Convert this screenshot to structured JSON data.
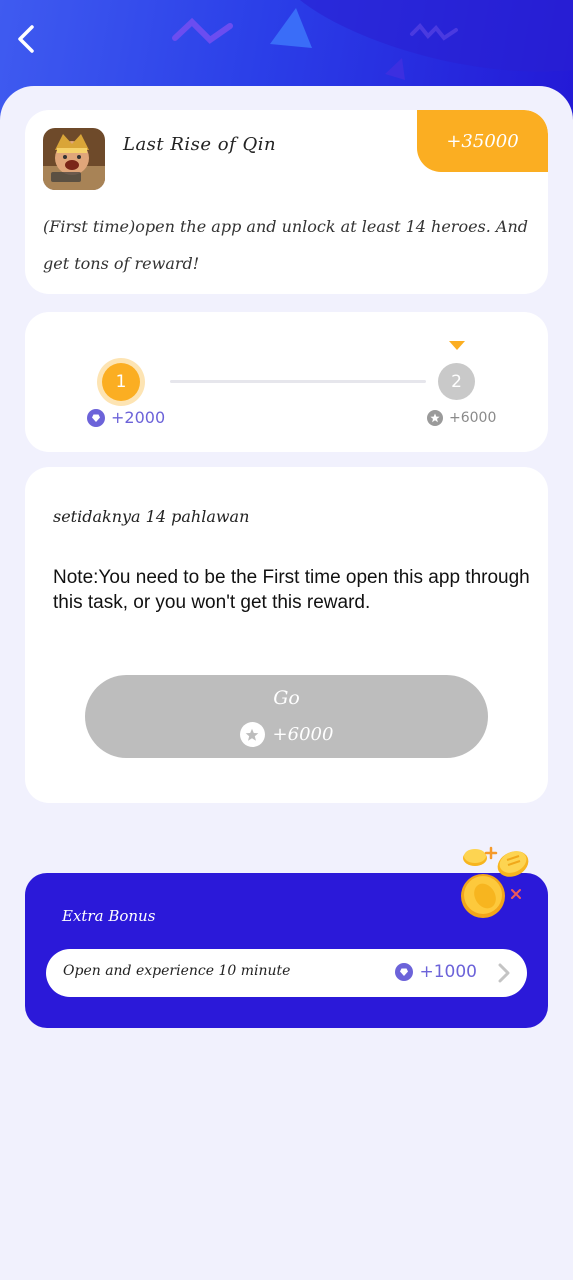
{
  "header": {
    "back_icon": "chevron-left-icon"
  },
  "task": {
    "app_name": "Last Rise of Qin",
    "total_reward": "+35000",
    "description": "(First time)open the app and unlock at least 14 heroes. And get tons of reward!"
  },
  "progress": {
    "steps": [
      {
        "number": "1",
        "reward": "+2000",
        "state": "active"
      },
      {
        "number": "2",
        "reward": "+6000",
        "state": "pending"
      }
    ]
  },
  "detail": {
    "title": "setidaknya 14 pahlawan",
    "note": "Note:You need to be the First time open this app through this task, or you won't get this reward.",
    "button_label": "Go",
    "button_reward": "+6000"
  },
  "bonus": {
    "title": "Extra Bonus",
    "item_text": "Open and experience 10 minute",
    "item_reward": "+1000"
  },
  "colors": {
    "accent_orange": "#fbae22",
    "accent_purple": "#6c63d9",
    "bonus_blue": "#2b19d9",
    "button_grey": "#bdbdbd"
  }
}
